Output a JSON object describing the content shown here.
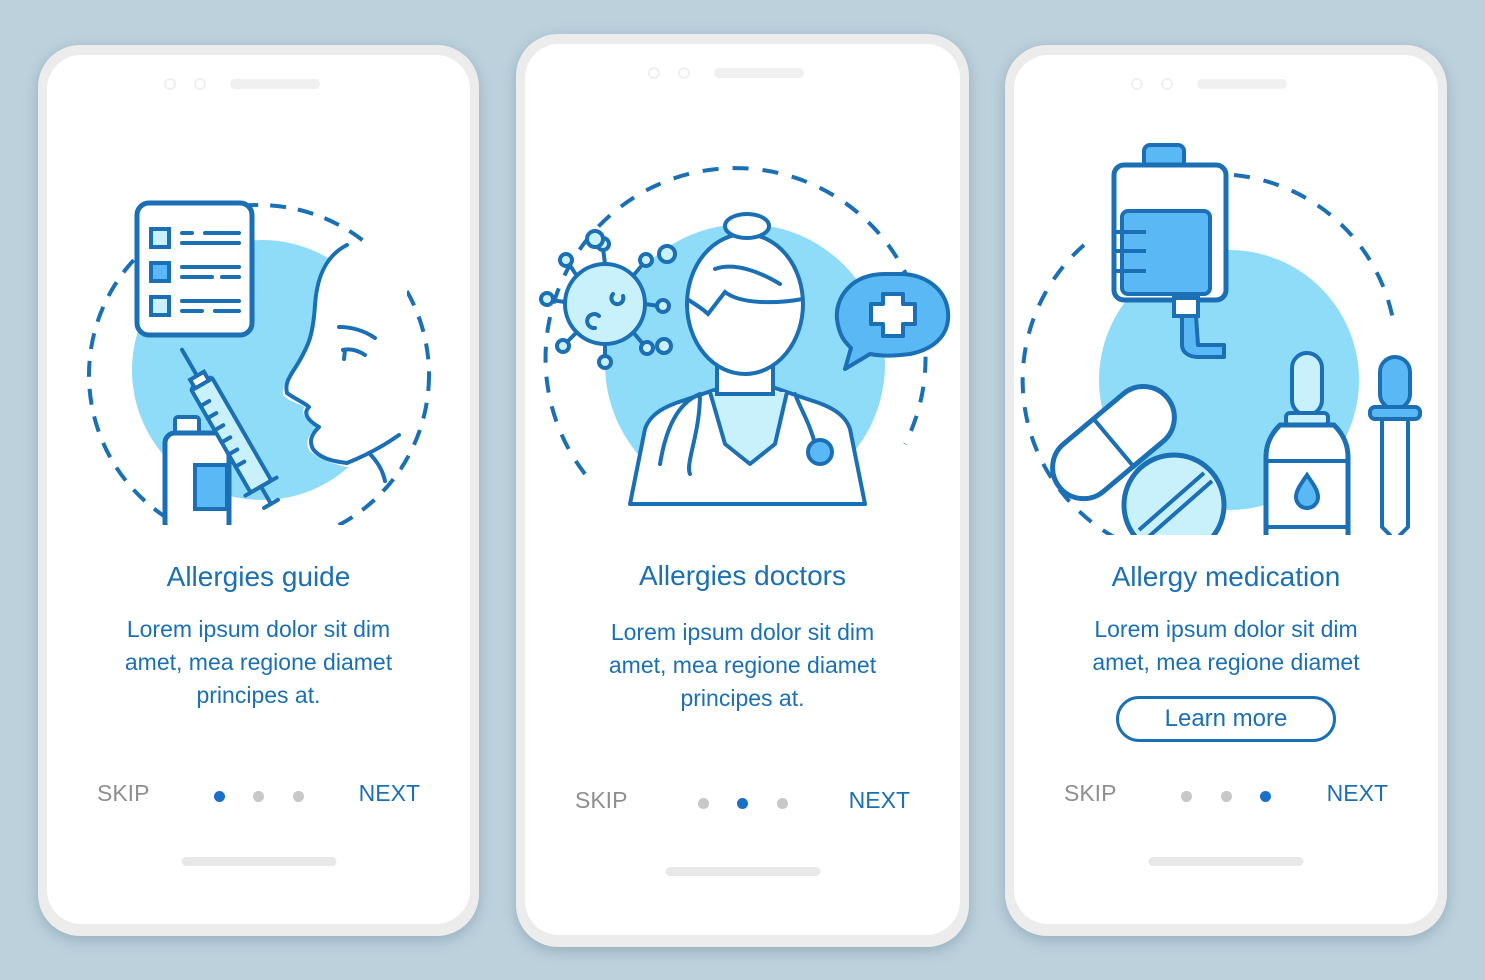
{
  "colors": {
    "background": "#bcd1dc",
    "accent": "#1a6fb5",
    "accent_light": "#8fdcf9",
    "muted": "#8f8f8f",
    "dot_inactive": "#c8c8c8",
    "dot_active": "#1a6fc8"
  },
  "screens": [
    {
      "title": "Allergies guide",
      "body": [
        "Lorem ipsum dolor sit dim",
        "amet, mea regione diamet",
        "principes at."
      ],
      "illustration": "allergy-test-checklist-syringe-face",
      "skip_label": "SKIP",
      "next_label": "NEXT",
      "page_index": 1,
      "page_count": 3
    },
    {
      "title": "Allergies doctors",
      "body": [
        "Lorem ipsum dolor sit dim",
        "amet, mea regione diamet",
        "principes at."
      ],
      "illustration": "doctor-virus-medical-chat",
      "skip_label": "SKIP",
      "next_label": "NEXT",
      "page_index": 2,
      "page_count": 3
    },
    {
      "title": "Allergy medication",
      "body": [
        "Lorem ipsum dolor sit dim",
        "amet, mea regione diamet"
      ],
      "illustration": "iv-bag-pills-drops-pipette",
      "button_label": "Learn more",
      "skip_label": "SKIP",
      "next_label": "NEXT",
      "page_index": 3,
      "page_count": 3
    }
  ]
}
